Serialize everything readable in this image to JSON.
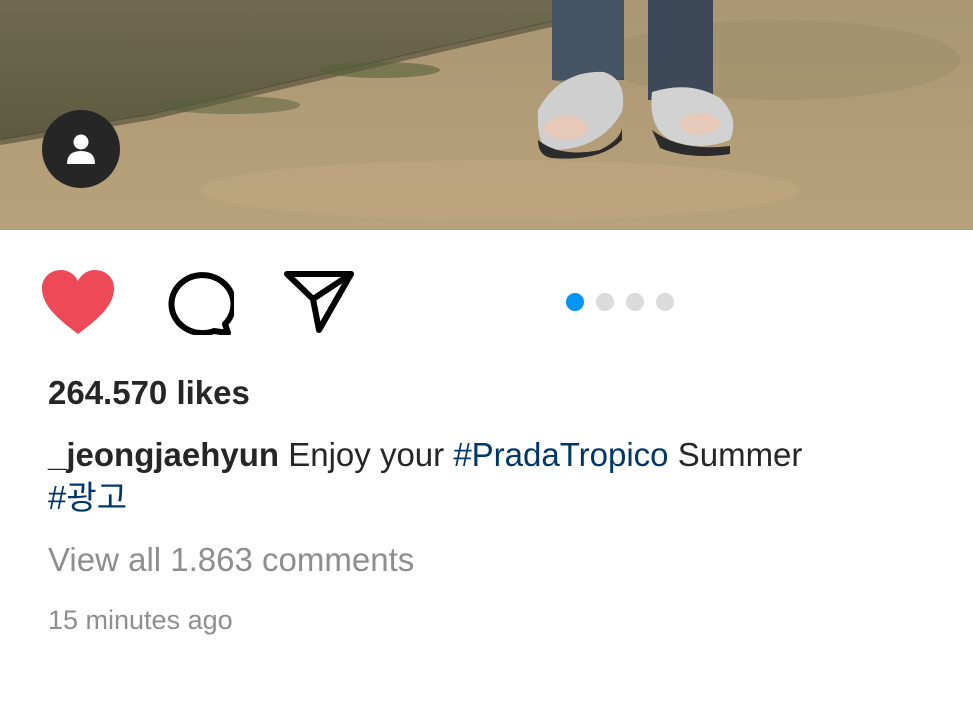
{
  "post": {
    "photo": {
      "description_icon": "photo",
      "tag_icon": "person-icon"
    },
    "actions": {
      "like_icon": "heart-icon",
      "like_state": "liked",
      "like_color": "#ed4956",
      "comment_icon": "comment-icon",
      "share_icon": "paper-plane-icon"
    },
    "carousel": {
      "total": 4,
      "active_index": 0,
      "active_color": "#0095f6",
      "inactive_color": "#dbdbdb"
    },
    "likes_text": "264.570 likes",
    "caption": {
      "username": "_jeongjaehyun",
      "text_before": " Enjoy your ",
      "hashtag_1": "#PradaTropico",
      "text_after": " Summer",
      "hashtag_2": "#광고",
      "hashtag_color": "#00376b"
    },
    "view_comments_text": "View all 1.863 comments",
    "timestamp": "15 minutes ago"
  }
}
